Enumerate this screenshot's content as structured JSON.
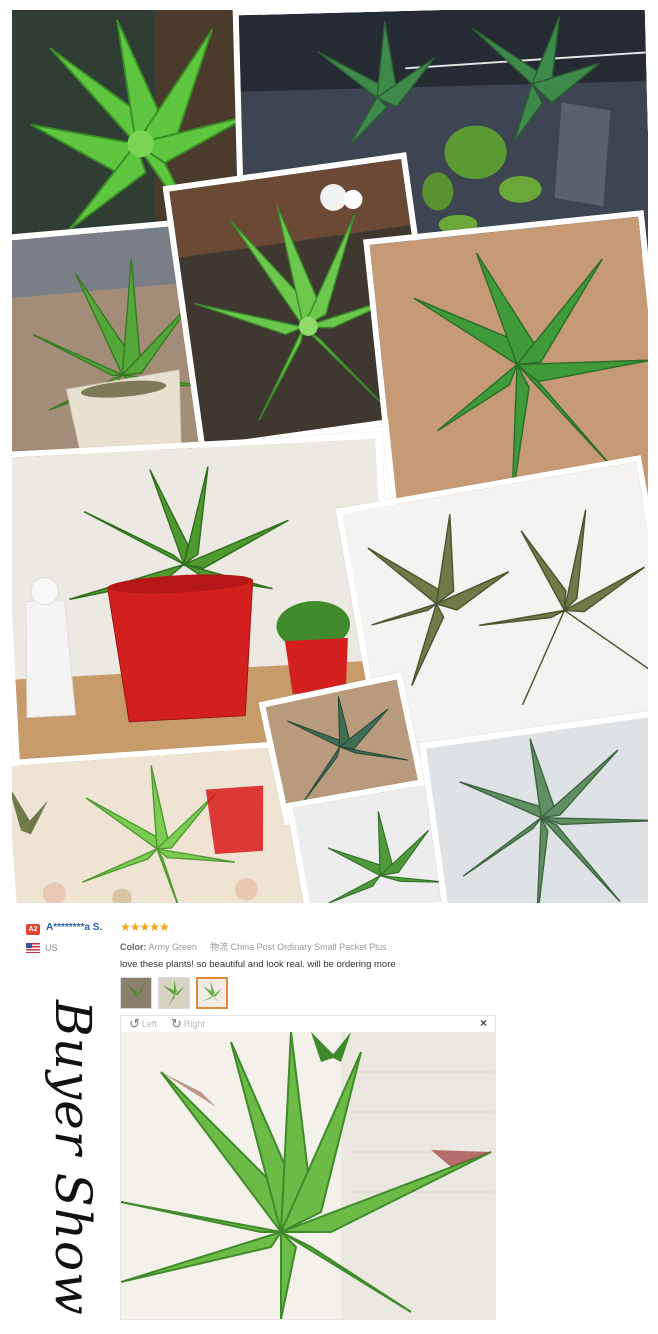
{
  "review": {
    "badge": "A2",
    "reviewer": "A********a S.",
    "stars": "★★★★★",
    "country": "US",
    "color_label": "Color:",
    "color_value": "Army Green",
    "shipping_label": "物流",
    "shipping_value": "China Post Ordinary Small Packet Plus",
    "comment": "love these plants! so beautiful and look real. will be ordering more",
    "rotate_left": "Left",
    "rotate_right": "Right",
    "close": "×",
    "thumbnails": [
      "plant-photo-1",
      "plant-photo-2",
      "plant-photo-3"
    ],
    "active_thumbnail": 3
  },
  "side_title": "Buyer Show",
  "icons": {
    "flag": "us-flag-icon",
    "rotate_left": "rotate-left-icon",
    "rotate_right": "rotate-right-icon",
    "close": "close-icon",
    "star": "star-icon"
  },
  "colors": {
    "badge": "#e4432f",
    "reviewer_link": "#2a5ca8",
    "stars": "#f7a21b",
    "active_thumb_border": "#e08a3a",
    "leaf_green": "#5aa83a",
    "pot_red": "#d41f1f"
  }
}
